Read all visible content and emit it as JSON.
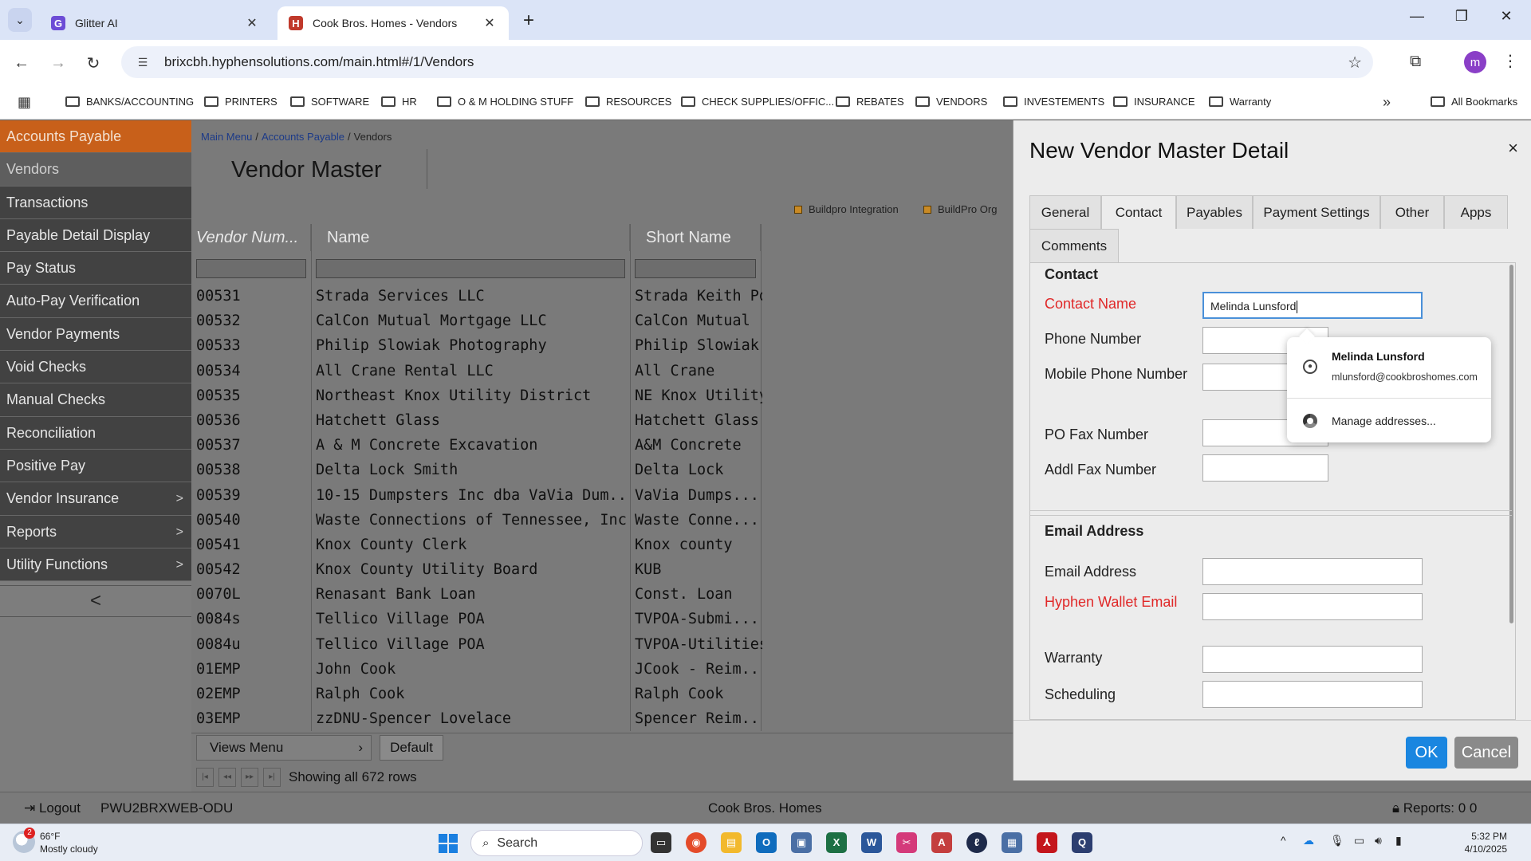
{
  "browser": {
    "tabs": [
      {
        "title": "Glitter AI",
        "favicon_color": "#6c4cd6",
        "favicon_letter": "G"
      },
      {
        "title": "Cook Bros. Homes - Vendors",
        "favicon_color": "#c0392b",
        "favicon_letter": "H"
      }
    ],
    "url": "brixcbh.hyphensolutions.com/main.html#/1/Vendors",
    "profile_initial": "m",
    "bookmarks": [
      "BANKS/ACCOUNTING",
      "PRINTERS",
      "SOFTWARE",
      "HR",
      "O & M HOLDING STUFF",
      "RESOURCES",
      "CHECK SUPPLIES/OFFIC...",
      "REBATES",
      "VENDORS",
      "INVESTEMENTS",
      "INSURANCE",
      "Warranty"
    ],
    "all_bookmarks": "All Bookmarks"
  },
  "sidebar": {
    "header": "Accounts Payable",
    "items": [
      {
        "label": "Vendors",
        "arrow": ""
      },
      {
        "label": "Transactions",
        "arrow": ""
      },
      {
        "label": "Payable Detail Display",
        "arrow": ""
      },
      {
        "label": "Pay Status",
        "arrow": ""
      },
      {
        "label": "Auto-Pay Verification",
        "arrow": ""
      },
      {
        "label": "Vendor Payments",
        "arrow": ""
      },
      {
        "label": "Void Checks",
        "arrow": ""
      },
      {
        "label": "Manual Checks",
        "arrow": ""
      },
      {
        "label": "Reconciliation",
        "arrow": ""
      },
      {
        "label": "Positive Pay",
        "arrow": ""
      },
      {
        "label": "Vendor Insurance",
        "arrow": ">"
      },
      {
        "label": "Reports",
        "arrow": ">"
      },
      {
        "label": "Utility Functions",
        "arrow": ">"
      }
    ],
    "collapse": "<"
  },
  "main": {
    "breadcrumb": [
      "Main Menu",
      "Accounts Payable",
      "Vendors"
    ],
    "title": "Vendor Master",
    "legend": [
      "Buildpro Integration",
      "BuildPro Org"
    ],
    "columns": [
      "Vendor Num...",
      "Name",
      "Short Name"
    ],
    "rows": [
      [
        "00531",
        "Strada Services LLC",
        "Strada Keith Po"
      ],
      [
        "00532",
        "CalCon Mutual Mortgage LLC",
        "CalCon Mutual"
      ],
      [
        "00533",
        "Philip Slowiak Photography",
        "Philip Slowiak"
      ],
      [
        "00534",
        "All Crane Rental LLC",
        "All Crane"
      ],
      [
        "00535",
        "Northeast Knox Utility District",
        "NE Knox Utility"
      ],
      [
        "00536",
        "Hatchett Glass",
        "Hatchett Glass"
      ],
      [
        "00537",
        "A & M Concrete Excavation",
        "A&M Concrete"
      ],
      [
        "00538",
        "Delta Lock Smith",
        "Delta Lock"
      ],
      [
        "00539",
        "10-15 Dumpsters Inc dba VaVia Dum...",
        "VaVia Dumps..."
      ],
      [
        "00540",
        "Waste Connections of Tennessee, Inc",
        "Waste Conne..."
      ],
      [
        "00541",
        "Knox County Clerk",
        "Knox county"
      ],
      [
        "00542",
        "Knox County Utility Board",
        "KUB"
      ],
      [
        "0070L",
        "Renasant Bank Loan",
        "Const. Loan"
      ],
      [
        "0084s",
        "Tellico Village POA",
        "TVPOA-Submi..."
      ],
      [
        "0084u",
        "Tellico Village POA",
        "TVPOA-Utilities"
      ],
      [
        "01EMP",
        "John Cook",
        "JCook - Reim..."
      ],
      [
        "02EMP",
        "Ralph Cook",
        "Ralph Cook"
      ],
      [
        "03EMP",
        "zzDNU-Spencer Lovelace",
        "Spencer Reim..."
      ]
    ],
    "views_menu": "Views Menu",
    "views_default": "Default",
    "row_count": "Showing all 672 rows"
  },
  "status": {
    "logout": "Logout",
    "server": "PWU2BRXWEB-ODU",
    "company": "Cook Bros. Homes",
    "reports": "Reports: 0 0"
  },
  "modal": {
    "title": "New Vendor Master Detail",
    "close": "×",
    "tabs": [
      "General",
      "Contact",
      "Payables",
      "Payment Settings",
      "Other",
      "Apps",
      "Comments"
    ],
    "active_tab": "Contact",
    "contact_section": "Contact",
    "contact_fields": [
      {
        "label": "Contact Name",
        "value": "Melinda Lunsford",
        "required": true
      },
      {
        "label": "Phone Number",
        "value": "",
        "required": false
      },
      {
        "label": "Mobile Phone Number",
        "value": "",
        "required": false
      },
      {
        "label": "PO Fax Number",
        "value": "",
        "required": false
      },
      {
        "label": "Addl Fax Number",
        "value": "",
        "required": false
      }
    ],
    "email_section": "Email Address",
    "email_fields": [
      {
        "label": "Email Address",
        "value": "",
        "required": false
      },
      {
        "label": "Hyphen Wallet Email",
        "value": "",
        "required": true
      },
      {
        "label": "Warranty",
        "value": "",
        "required": false
      },
      {
        "label": "Scheduling",
        "value": "",
        "required": false
      }
    ],
    "ok": "OK",
    "cancel": "Cancel"
  },
  "autocomplete": {
    "name": "Melinda Lunsford",
    "email": "mlunsford@cookbroshomes.com",
    "manage": "Manage addresses..."
  },
  "taskbar": {
    "temp": "66°F",
    "weather": "Mostly cloudy",
    "badge": "2",
    "search": "Search",
    "time": "5:32 PM",
    "date": "4/10/2025"
  }
}
